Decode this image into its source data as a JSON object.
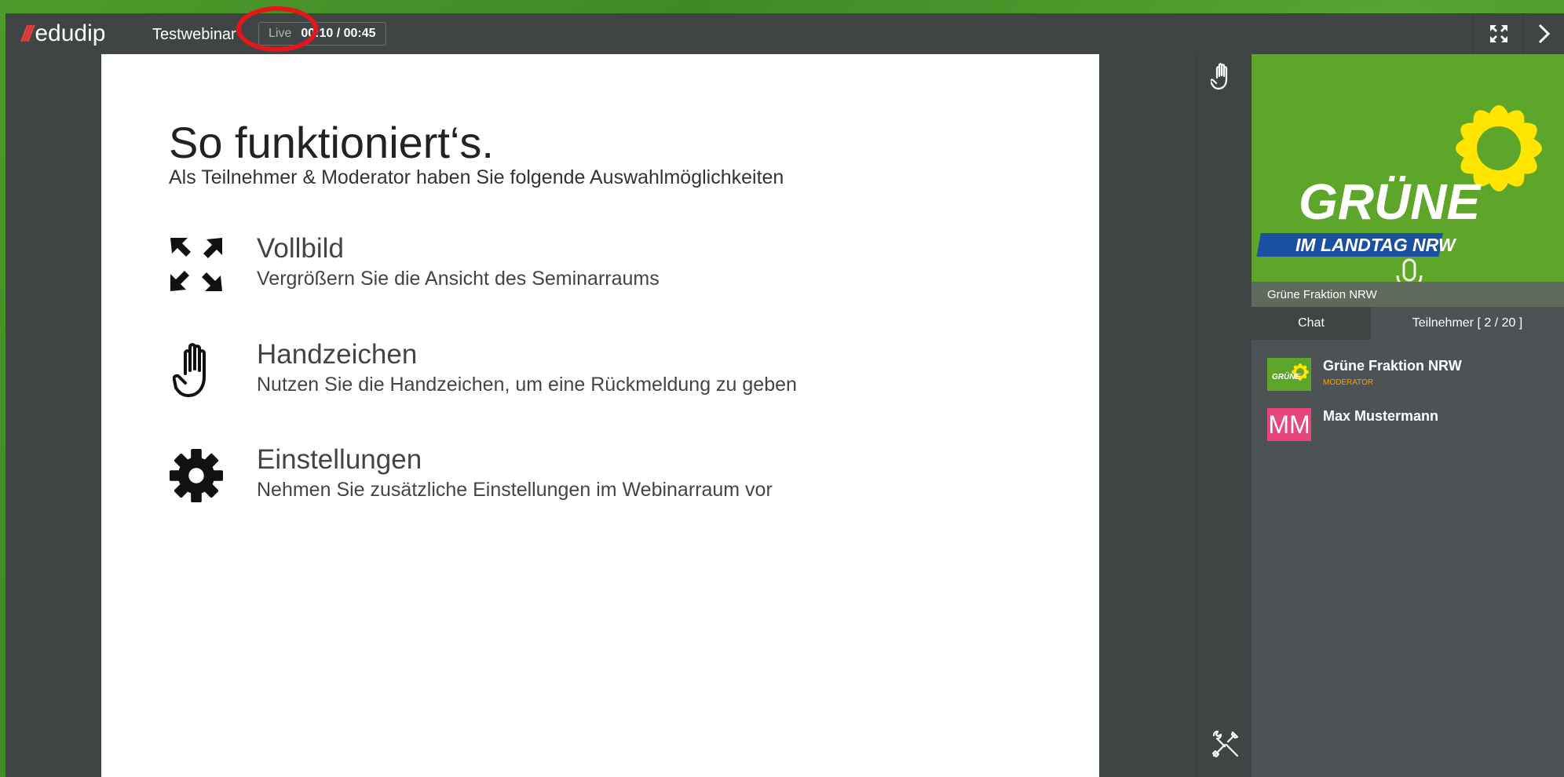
{
  "topbar": {
    "logo_slashes": "///",
    "logo_text": "edudip",
    "title": "Testwebinar",
    "live_label": "Live",
    "time": "00:10 / 00:45",
    "fullscreen_icon": "fullscreen-icon",
    "collapse_icon": "chevron-right-icon"
  },
  "slide": {
    "title": "So funktioniert‘s.",
    "subtitle": "Als Teilnehmer & Moderator haben Sie folgende Auswahlmöglichkeiten",
    "features": [
      {
        "icon": "expand-arrows-icon",
        "heading": "Vollbild",
        "description": "Vergrößern Sie die Ansicht des Seminarraums"
      },
      {
        "icon": "hand-icon",
        "heading": "Handzeichen",
        "description": "Nutzen Sie die Handzeichen, um eine Rückmeldung zu geben"
      },
      {
        "icon": "gear-icon",
        "heading": "Einstellungen",
        "description": "Nehmen Sie zusätzliche Einstellungen im Webinarraum vor"
      }
    ]
  },
  "side_tools": {
    "raise_hand_icon": "hand-icon",
    "settings_icon": "tools-icon"
  },
  "panel": {
    "video": {
      "logo_line1": "GRÜNE",
      "logo_line2": "IM LANDTAG NRW",
      "mic_icon": "microphone-icon"
    },
    "video_name": "Grüne Fraktion NRW",
    "tabs": [
      {
        "label": "Chat",
        "active": true
      },
      {
        "label": "Teilnehmer [ 2 / 20 ]",
        "active": false
      }
    ],
    "participants": [
      {
        "name": "Grüne Fraktion NRW",
        "role": "Moderator",
        "avatar_text": "GRÜNE",
        "avatar_color": "#5da62a"
      },
      {
        "name": "Max Mustermann",
        "role": "",
        "avatar_text": "MM",
        "avatar_color": "#e8457a"
      }
    ]
  },
  "colors": {
    "accent_green": "#5da62a",
    "dark_gray": "#3f4445",
    "highlight_red": "#e3161b",
    "moderator_orange": "#f1a200"
  }
}
